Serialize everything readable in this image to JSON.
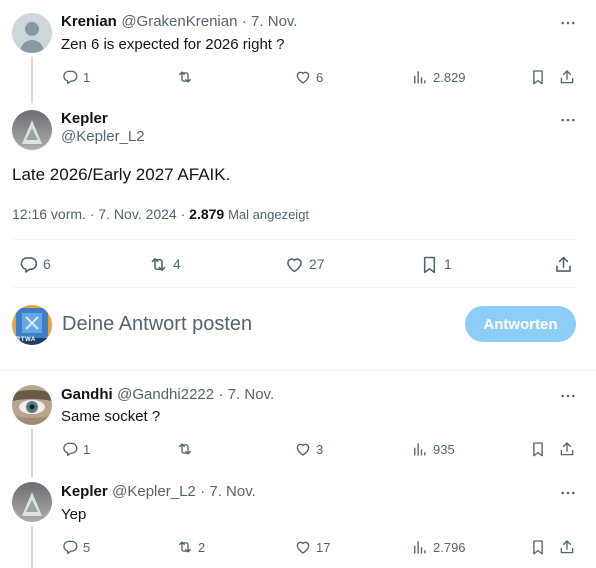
{
  "tweet_parent": {
    "name": "Krenian",
    "handle": "@GrakenKrenian",
    "date": "· 7. Nov.",
    "text": "Zen 6 is expected for 2026 right ?",
    "replies": "1",
    "retweets": "",
    "likes": "6",
    "views": "2.829"
  },
  "tweet_main": {
    "name": "Kepler",
    "handle": "@Kepler_L2",
    "text": "Late 2026/Early 2027 AFAIK.",
    "timestamp": "12:16 vorm. · 7. Nov. 2024 ·",
    "views_count": "2.879",
    "views_label": "Mal angezeigt",
    "replies": "6",
    "retweets": "4",
    "likes": "27",
    "bookmarks": "1"
  },
  "compose": {
    "placeholder": "Deine Antwort posten",
    "button": "Antworten",
    "avatar_text": "RTWA"
  },
  "reply1": {
    "name": "Gandhi",
    "handle": "@Gandhi2222",
    "date": "· 7. Nov.",
    "text": "Same socket ?",
    "replies": "1",
    "retweets": "",
    "likes": "3",
    "views": "935"
  },
  "reply2": {
    "name": "Kepler",
    "handle": "@Kepler_L2",
    "date": "· 7. Nov.",
    "text": "Yep",
    "replies": "5",
    "retweets": "2",
    "likes": "17",
    "views": "2.796"
  },
  "icons": {
    "reply": "reply-icon",
    "retweet": "retweet-icon",
    "like": "heart-icon",
    "views": "views-icon",
    "bookmark": "bookmark-icon",
    "share": "share-icon",
    "more": "more-icon"
  },
  "colors": {
    "accent_disabled": "#8ecdf8",
    "secondary_text": "#536471",
    "border": "#eff3f4"
  }
}
